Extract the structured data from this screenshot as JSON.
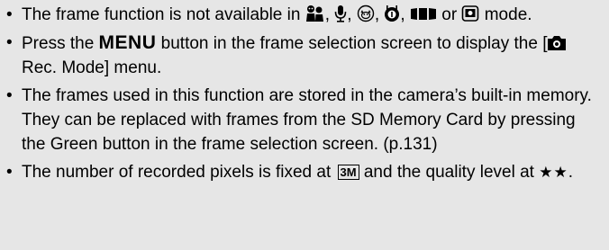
{
  "notes": [
    {
      "parts": {
        "a": "The frame function is not available in",
        "sep": ",",
        "or": "or",
        "b": "mode."
      },
      "icons": [
        "kids-mode-icon",
        "voice-memo-icon",
        "pet-mode-icon",
        "food-mode-icon",
        "digital-panorama-icon",
        "frame-composite-icon"
      ]
    },
    {
      "parts": {
        "a": "Press the",
        "key": "MENU",
        "b": "button in the frame selection screen to display the [",
        "c": "Rec. Mode] menu."
      },
      "icons": [
        "camera-icon"
      ]
    },
    {
      "text": "The frames used in this function are stored in the camera’s built-in memory. They can be replaced with frames from the SD Memory Card by pressing the Green button in the frame selection screen. (p.131)"
    },
    {
      "parts": {
        "a": "The number of recorded pixels is fixed at",
        "badge": "3M",
        "b": "and the quality level at",
        "stars": "★★",
        "end": "."
      }
    }
  ]
}
